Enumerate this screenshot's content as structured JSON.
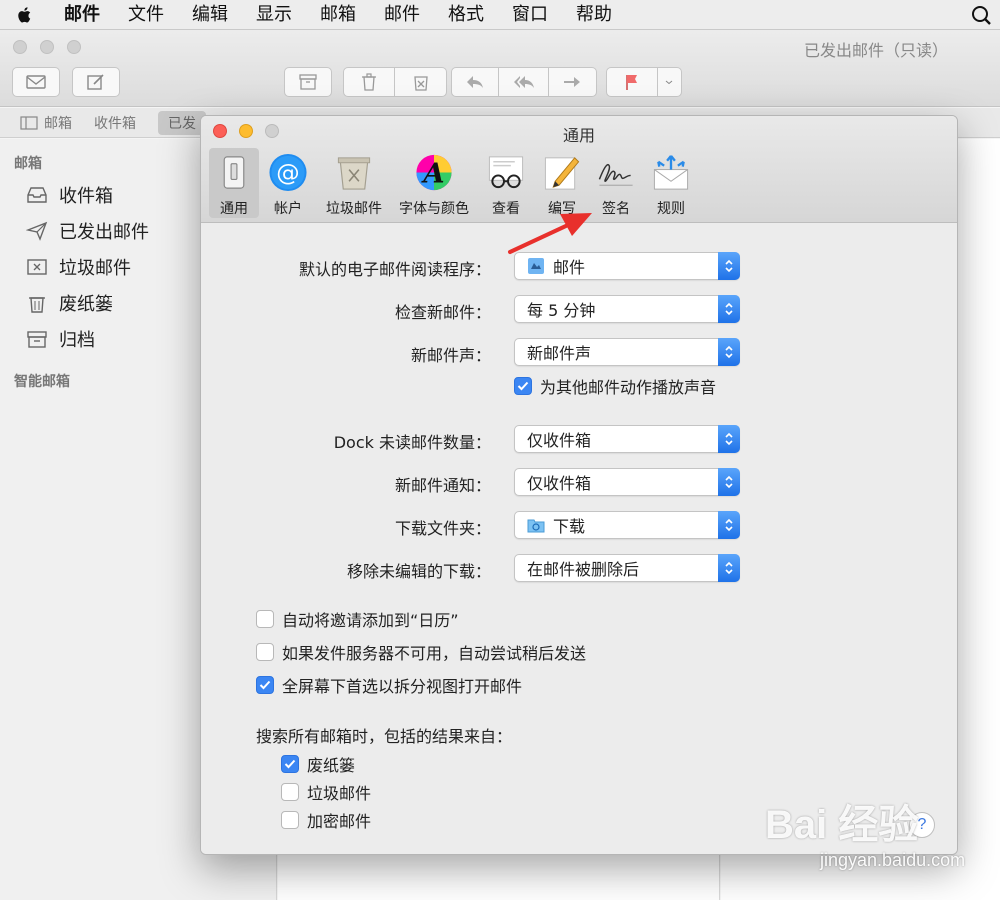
{
  "menubar": {
    "items": [
      "邮件",
      "文件",
      "编辑",
      "显示",
      "邮箱",
      "邮件",
      "格式",
      "窗口",
      "帮助"
    ]
  },
  "window": {
    "title": "已发出邮件（只读）"
  },
  "favorites": {
    "mailbox": "邮箱",
    "inbox": "收件箱",
    "sent": "已发"
  },
  "sidebar": {
    "heading": "邮箱",
    "items": [
      {
        "label": "收件箱",
        "icon": "inbox-icon"
      },
      {
        "label": "已发出邮件",
        "icon": "sent-icon"
      },
      {
        "label": "垃圾邮件",
        "icon": "junk-icon"
      },
      {
        "label": "废纸篓",
        "icon": "trash-icon"
      },
      {
        "label": "归档",
        "icon": "archive-icon"
      }
    ],
    "smart_heading": "智能邮箱"
  },
  "dialog": {
    "title": "通用",
    "tabs": [
      {
        "label": "通用",
        "icon": "general-switch-icon",
        "selected": true
      },
      {
        "label": "帐户",
        "icon": "at-sign-icon"
      },
      {
        "label": "垃圾邮件",
        "icon": "junk-bin-icon"
      },
      {
        "label": "字体与颜色",
        "icon": "font-color-icon"
      },
      {
        "label": "查看",
        "icon": "glasses-icon"
      },
      {
        "label": "编写",
        "icon": "pencil-icon"
      },
      {
        "label": "签名",
        "icon": "signature-icon"
      },
      {
        "label": "规则",
        "icon": "rules-icon"
      }
    ],
    "settings": {
      "default_reader": {
        "label": "默认的电子邮件阅读程序：",
        "value": "邮件"
      },
      "check_mail": {
        "label": "检查新邮件：",
        "value": "每 5 分钟"
      },
      "new_mail_sound": {
        "label": "新邮件声：",
        "value": "新邮件声"
      },
      "play_sounds": {
        "label": "为其他邮件动作播放声音",
        "checked": true
      },
      "dock_unread": {
        "label": "Dock 未读邮件数量：",
        "value": "仅收件箱"
      },
      "new_mail_notify": {
        "label": "新邮件通知：",
        "value": "仅收件箱"
      },
      "downloads_folder": {
        "label": "下载文件夹：",
        "value": "下载"
      },
      "remove_downloads": {
        "label": "移除未编辑的下载：",
        "value": "在邮件被删除后"
      },
      "add_invites": {
        "label": "自动将邀请添加到“日历”",
        "checked": false
      },
      "retry_send": {
        "label": "如果发件服务器不可用，自动尝试稍后发送",
        "checked": false
      },
      "split_view": {
        "label": "全屏幕下首选以拆分视图打开邮件",
        "checked": true
      },
      "search_heading": "搜索所有邮箱时，包括的结果来自：",
      "search_trash": {
        "label": "废纸篓",
        "checked": true
      },
      "search_junk": {
        "label": "垃圾邮件",
        "checked": false
      },
      "search_encrypted": {
        "label": "加密邮件",
        "checked": false
      }
    },
    "help_label": "?"
  },
  "watermark": {
    "brand": "Bai 经验",
    "url": "jingyan.baidu.com"
  },
  "colors": {
    "accent": "#3b86f3",
    "close": "#fc5f57",
    "minimize": "#fdbc2e",
    "annotation_arrow": "#e8302c"
  }
}
